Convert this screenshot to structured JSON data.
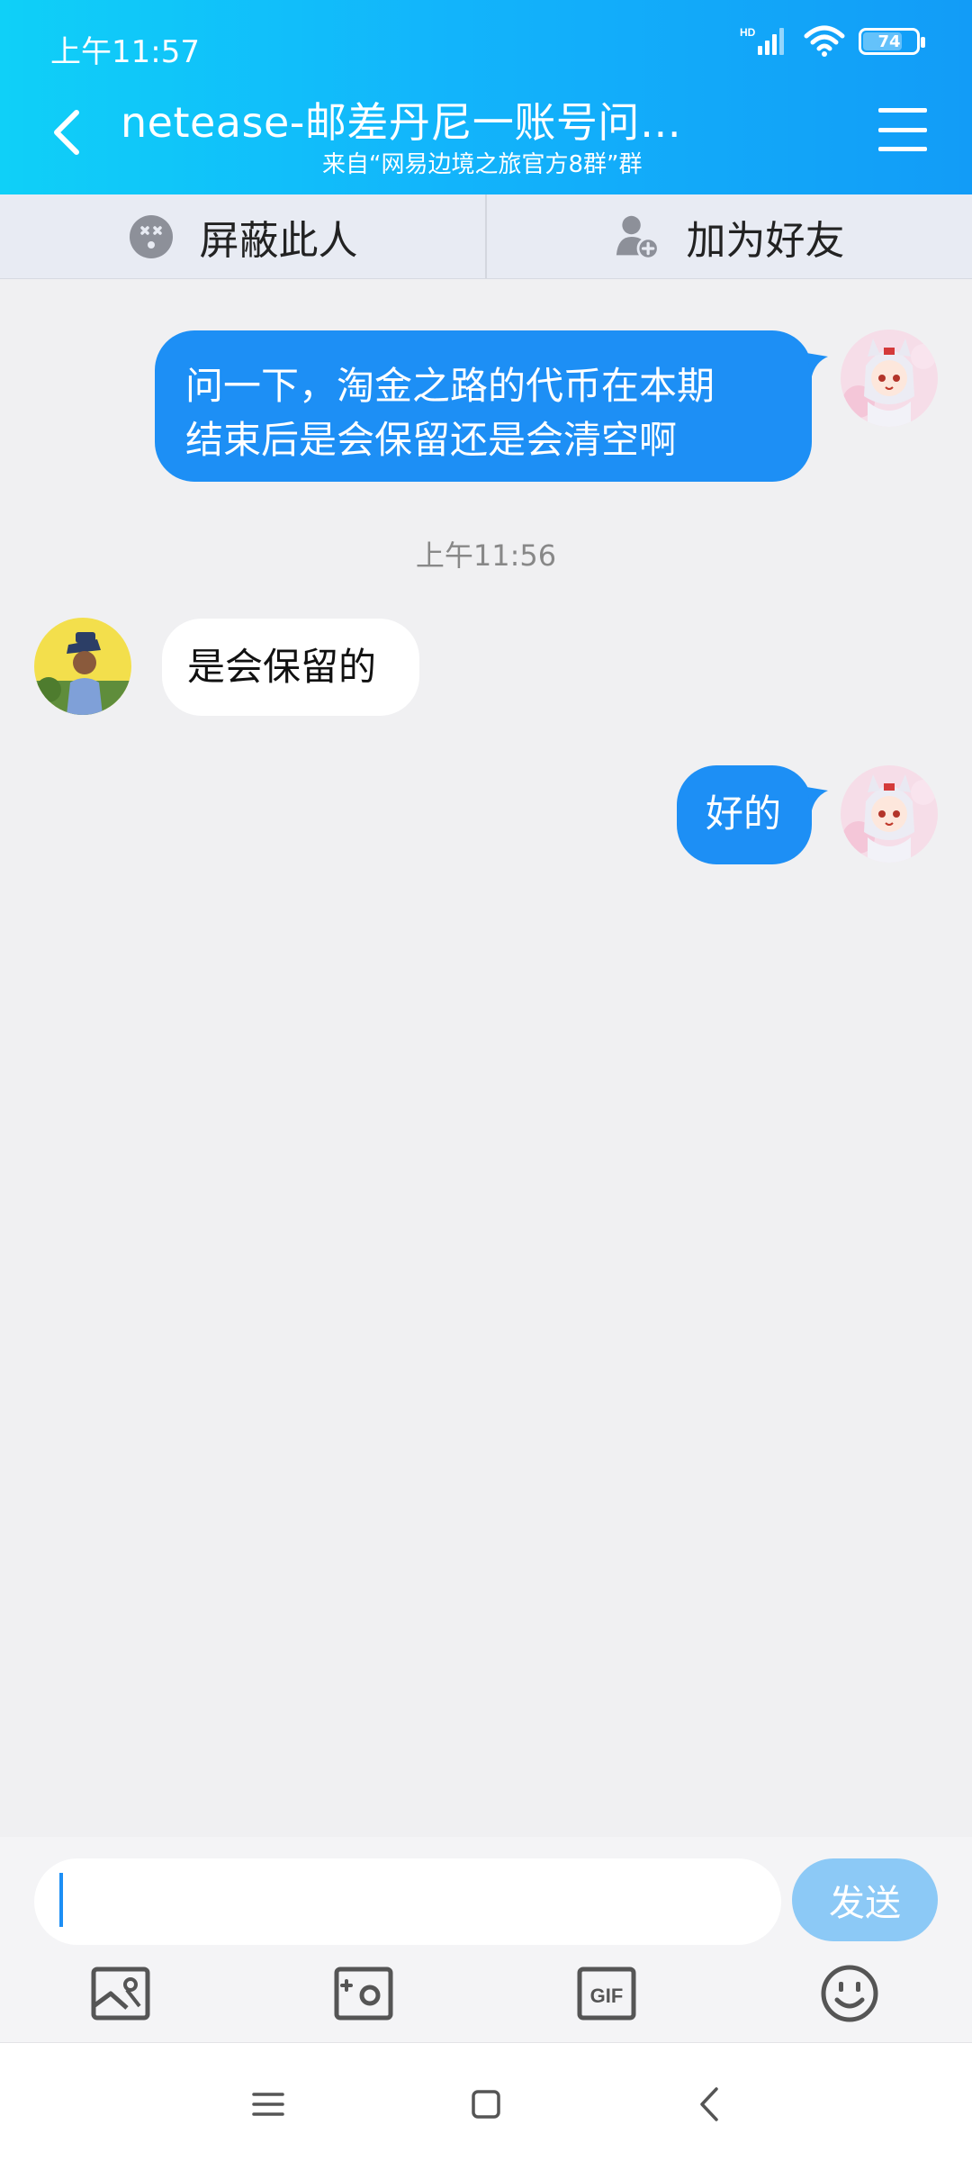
{
  "status_bar": {
    "time": "上午11:57",
    "network_label": "HD",
    "battery": "74",
    "battery_level_percent": 74
  },
  "header": {
    "title": "netease-邮差丹尼一账号问…",
    "subtitle": "来自“网易边境之旅官方8群”群",
    "back_icon": "chevron-left-icon",
    "menu_icon": "hamburger-menu-icon"
  },
  "actions": {
    "block_label": "屏蔽此人",
    "block_icon": "block-face-icon",
    "add_friend_label": "加为好友",
    "add_friend_icon": "add-person-icon"
  },
  "messages": [
    {
      "side": "out",
      "lines": [
        "问一下，淘金之路的代币在本期",
        "结束后是会保留还是会清空啊"
      ]
    },
    {
      "side": "timestamp",
      "text": "上午11:56"
    },
    {
      "side": "in",
      "text": "是会保留的"
    },
    {
      "side": "out",
      "text": "好的"
    }
  ],
  "composer": {
    "input_value": "",
    "send_label": "发送",
    "tools": [
      "image-icon",
      "camera-icon",
      "gif-icon",
      "emoji-icon"
    ],
    "gif_label": "GIF"
  },
  "colors": {
    "header_gradient": [
      "#0fd0f8",
      "#129cf7"
    ],
    "outgoing_bubble": "#1d8ff5",
    "incoming_bubble": "#ffffff",
    "background": "#f0f0f2",
    "send_button": "#8cc9f6"
  }
}
